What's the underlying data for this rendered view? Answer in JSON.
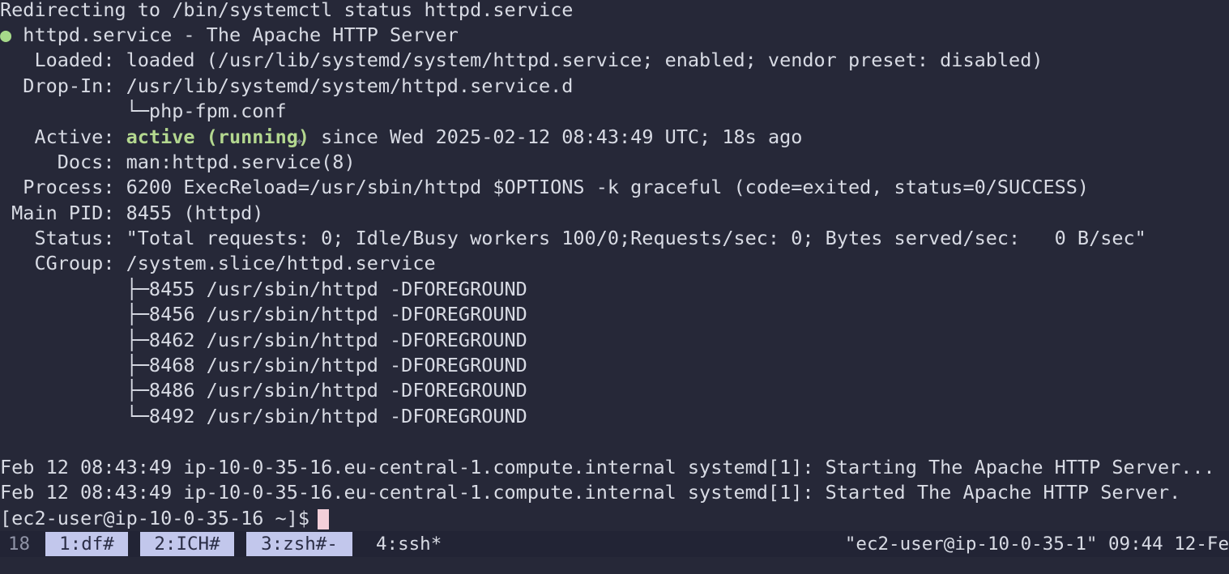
{
  "terminal": {
    "lines": {
      "l0": "Redirecting to /bin/systemctl status httpd.service",
      "l1_dot": "●",
      "l1": " httpd.service - The Apache HTTP Server",
      "l2": "   Loaded: loaded (/usr/lib/systemd/system/httpd.service; enabled; vendor preset: disabled)",
      "l3": "  Drop-In: /usr/lib/systemd/system/httpd.service.d",
      "l4": "           └─php-fpm.conf",
      "l5_label": "   Active: ",
      "l5_state": "active (running)",
      "l5_rest": " since Wed 2025-02-12 08:43:49 UTC; 18s ago",
      "l6": "     Docs: man:httpd.service(8)",
      "l7": "  Process: 6200 ExecReload=/usr/sbin/httpd $OPTIONS -k graceful (code=exited, status=0/SUCCESS)",
      "l8": " Main PID: 8455 (httpd)",
      "l9": "   Status: \"Total requests: 0; Idle/Busy workers 100/0;Requests/sec: 0; Bytes served/sec:   0 B/sec\"",
      "l10": "   CGroup: /system.slice/httpd.service",
      "l11": "           ├─8455 /usr/sbin/httpd -DFOREGROUND",
      "l12": "           ├─8456 /usr/sbin/httpd -DFOREGROUND",
      "l13": "           ├─8462 /usr/sbin/httpd -DFOREGROUND",
      "l14": "           ├─8468 /usr/sbin/httpd -DFOREGROUND",
      "l15": "           ├─8486 /usr/sbin/httpd -DFOREGROUND",
      "l16": "           └─8492 /usr/sbin/httpd -DFOREGROUND",
      "l18": "Feb 12 08:43:49 ip-10-0-35-16.eu-central-1.compute.internal systemd[1]: Starting The Apache HTTP Server...",
      "l19": "Feb 12 08:43:49 ip-10-0-35-16.eu-central-1.compute.internal systemd[1]: Started The Apache HTTP Server.",
      "prompt": "[ec2-user@ip-10-0-35-16 ~]$"
    },
    "cursor_color": "#f3cfd9"
  },
  "tmux": {
    "session": "18",
    "windows": {
      "w1": "1:df#",
      "w2": "2:ICH#",
      "w3": "3:zsh#-",
      "w4": "4:ssh*"
    },
    "right": "\"ec2-user@ip-10-0-35-1\" 09:44 12-Fe"
  },
  "colors": {
    "background": "#262838",
    "active_state": "#b3d78f",
    "window_tab_bg": "#c2c7ec"
  }
}
